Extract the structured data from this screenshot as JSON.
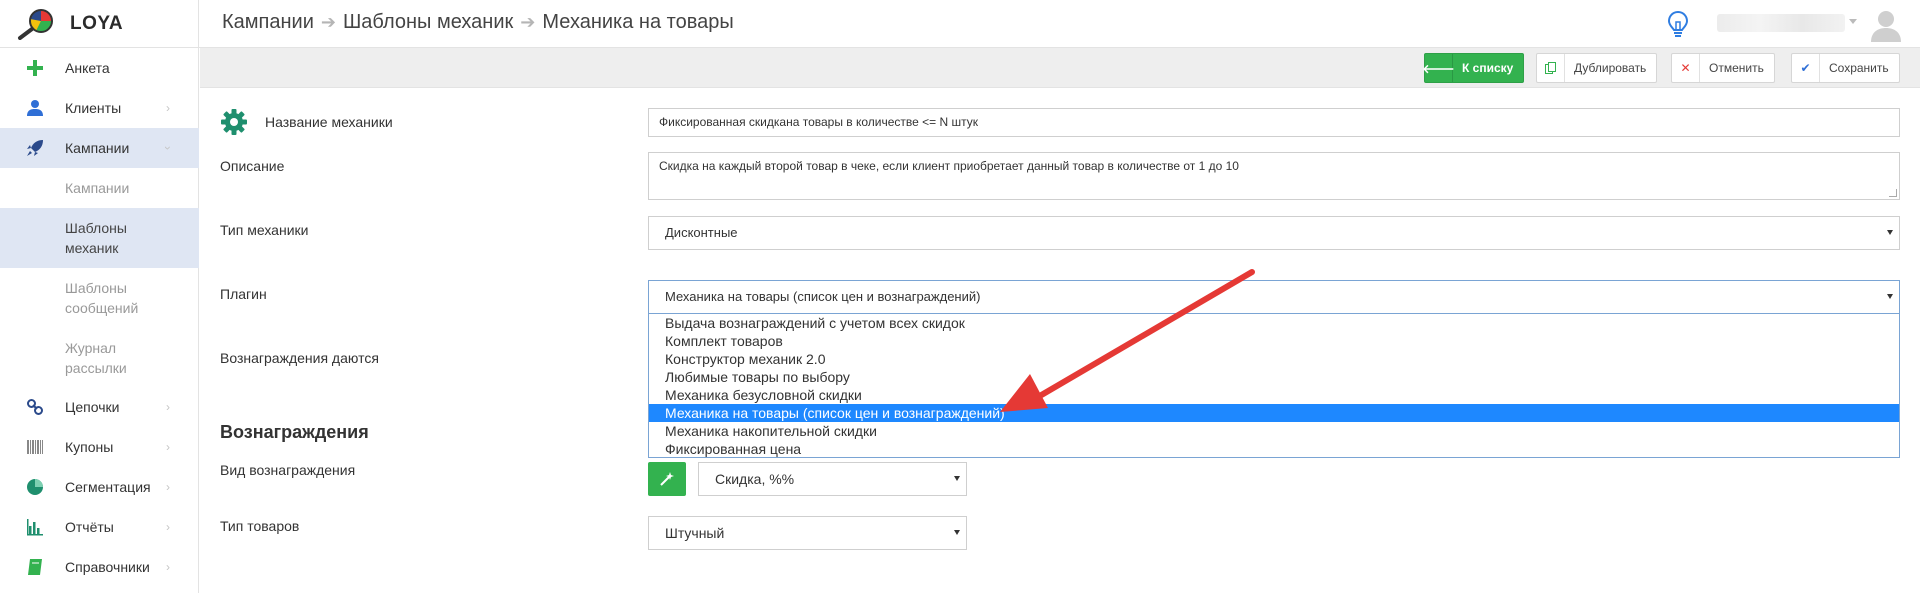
{
  "app": {
    "logo_text": "LOYA"
  },
  "breadcrumb": [
    "Кампании",
    "Шаблоны механик",
    "Механика на товары"
  ],
  "sidebar": {
    "items": [
      {
        "label": "Анкета",
        "icon": "plus-icon"
      },
      {
        "label": "Клиенты",
        "icon": "user-icon"
      },
      {
        "label": "Кампании",
        "icon": "rocket-icon"
      },
      {
        "label": "Цепочки",
        "icon": "chain-icon"
      },
      {
        "label": "Купоны",
        "icon": "barcode-icon"
      },
      {
        "label": "Сегментация",
        "icon": "pie-chart-icon"
      },
      {
        "label": "Отчёты",
        "icon": "bar-chart-icon"
      },
      {
        "label": "Справочники",
        "icon": "book-icon"
      }
    ],
    "sub_items": [
      {
        "label": "Кампании"
      },
      {
        "label_lines": [
          "Шаблоны",
          "механик"
        ]
      },
      {
        "label_lines": [
          "Шаблоны",
          "сообщений"
        ]
      },
      {
        "label_lines": [
          "Журнал",
          "рассылки"
        ]
      }
    ]
  },
  "toolbar": {
    "back_label": "К списку",
    "duplicate_label": "Дублировать",
    "cancel_label": "Отменить",
    "save_label": "Сохранить"
  },
  "form": {
    "name_label": "Название механики",
    "name_value": "Фиксированная скидкана товары в количестве <= N штук",
    "description_label": "Описание",
    "description_value": "Скидка на каждый второй товар в чеке, если клиент приобретает данный товар в количестве от 1 до 10",
    "type_label": "Тип механики",
    "type_value": "Дисконтные",
    "plugin_label": "Плагин",
    "plugin_value": "Механика на товары (список цен и вознаграждений)",
    "rewards_given_label": "Вознаграждения даются",
    "plugin_options": [
      "Выдача вознаграждений с учетом всех скидок",
      "Комплект товаров",
      "Конструктор механик 2.0",
      "Любимые товары по выбору",
      "Механика безусловной скидки",
      "Механика на товары (список цен и вознаграждений)",
      "Механика накопительной скидки",
      "Фиксированная цена"
    ],
    "selected_option_index": 5,
    "rewards_heading": "Вознаграждения",
    "reward_type_label": "Вид вознаграждения",
    "reward_type_value": "Скидка, %%",
    "goods_type_label": "Тип товаров",
    "goods_type_value": "Штучный"
  },
  "colors": {
    "accent_green": "#33b24f",
    "selection_blue": "#1e88ff",
    "annotation_red": "#e53935",
    "active_nav_bg": "#dfe6f3"
  }
}
